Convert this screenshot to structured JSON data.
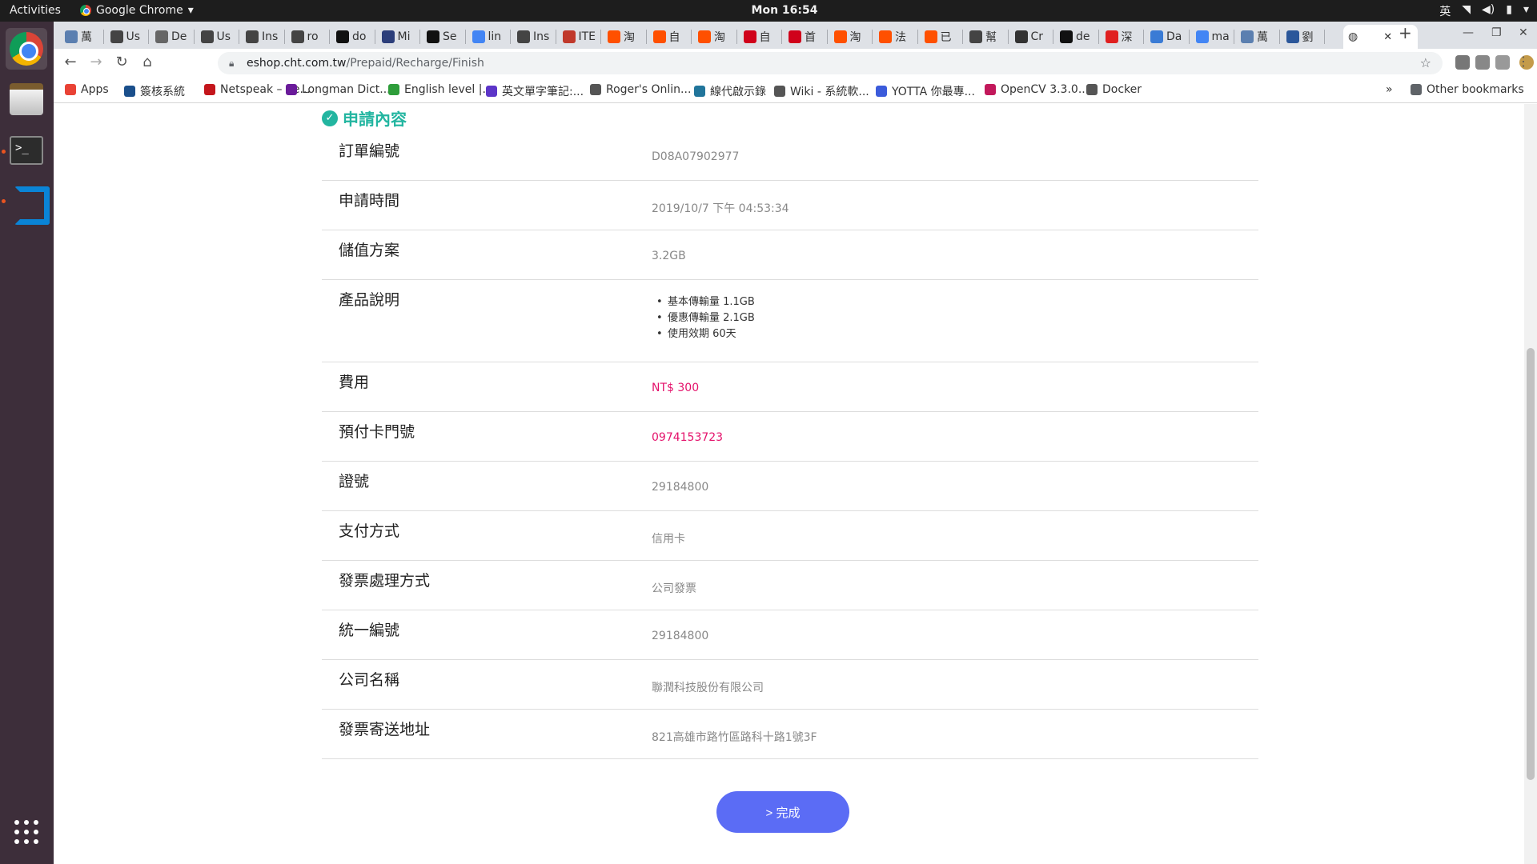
{
  "topbar": {
    "activities": "Activities",
    "app_name": "Google Chrome",
    "clock": "Mon 16:54",
    "ime": "英"
  },
  "tabs": [
    {
      "label": "萬",
      "color": "#5b7fb0"
    },
    {
      "label": "Us",
      "color": "#444"
    },
    {
      "label": "De",
      "color": "#666"
    },
    {
      "label": "Us",
      "color": "#444"
    },
    {
      "label": "Ins",
      "color": "#444"
    },
    {
      "label": "ro",
      "color": "#444"
    },
    {
      "label": "do",
      "color": "#111"
    },
    {
      "label": "Mi",
      "color": "#2c3e7a"
    },
    {
      "label": "Se",
      "color": "#111"
    },
    {
      "label": "lin",
      "color": "#4285f4"
    },
    {
      "label": "Ins",
      "color": "#444"
    },
    {
      "label": "ITE",
      "color": "#c0392b"
    },
    {
      "label": "淘",
      "color": "#ff5000"
    },
    {
      "label": "自",
      "color": "#ff5000"
    },
    {
      "label": "淘",
      "color": "#ff5000"
    },
    {
      "label": "自",
      "color": "#d0021b"
    },
    {
      "label": "首",
      "color": "#d0021b"
    },
    {
      "label": "淘",
      "color": "#ff5000"
    },
    {
      "label": "法",
      "color": "#ff5000"
    },
    {
      "label": "已",
      "color": "#ff5000"
    },
    {
      "label": "幫",
      "color": "#444"
    },
    {
      "label": "Cr",
      "color": "#333"
    },
    {
      "label": "de",
      "color": "#111"
    },
    {
      "label": "深",
      "color": "#e02020"
    },
    {
      "label": "Da",
      "color": "#3a7bd5"
    },
    {
      "label": "ma",
      "color": "#4285f4"
    },
    {
      "label": "萬",
      "color": "#5b7fb0"
    },
    {
      "label": "劉",
      "color": "#2b579a"
    }
  ],
  "address": {
    "host": "eshop.cht.com.tw",
    "path": "/Prepaid/Recharge/Finish"
  },
  "bookmarks": [
    {
      "label": "Apps",
      "color": "#e94235"
    },
    {
      "label": "簽核系統",
      "color": "#1a4f8b"
    },
    {
      "label": "Netspeak – Se...",
      "color": "#c4161c"
    },
    {
      "label": "Longman Dict...",
      "color": "#6a1b9a"
    },
    {
      "label": "English level |...",
      "color": "#2e9d3a"
    },
    {
      "label": "英文單字筆記:...",
      "color": "#5c35c8"
    },
    {
      "label": "Roger's Onlin...",
      "color": "#555"
    },
    {
      "label": "線代啟示錄",
      "color": "#21759b"
    },
    {
      "label": "Wiki - 系統軟...",
      "color": "#555"
    },
    {
      "label": "YOTTA 你最專...",
      "color": "#3b5bdb"
    },
    {
      "label": "OpenCV 3.3.0...",
      "color": "#c2185b"
    },
    {
      "label": "Docker",
      "color": "#555"
    }
  ],
  "bookmarks_more": "»",
  "other_bookmarks": "Other bookmarks",
  "page": {
    "section_title": "申請內容",
    "rows": [
      {
        "label": "訂單編號",
        "value": "D08A07902977"
      },
      {
        "label": "申請時間",
        "value": "2019/10/7 下午 04:53:34"
      },
      {
        "label": "儲值方案",
        "value": "3.2GB"
      },
      {
        "label": "產品說明",
        "items": [
          "基本傳輸量 1.1GB",
          "優惠傳輸量 2.1GB",
          "使用效期 60天"
        ]
      },
      {
        "label": "費用",
        "value": "NT$ 300"
      },
      {
        "label": "預付卡門號",
        "value": "0974153723"
      },
      {
        "label": "證號",
        "value": "29184800"
      },
      {
        "label": "支付方式",
        "value": "信用卡"
      },
      {
        "label": "發票處理方式",
        "value": "公司發票"
      },
      {
        "label": "統一編號",
        "value": "29184800"
      },
      {
        "label": "公司名稱",
        "value": "聯潤科技股份有限公司"
      },
      {
        "label": "發票寄送地址",
        "value": "821高雄市路竹區路科十路1號3F"
      }
    ],
    "done_button": "> 完成"
  },
  "colors": {
    "accent_teal": "#22b5a0",
    "highlight_red": "#e4126b",
    "button_blue": "#5b6cf5"
  }
}
